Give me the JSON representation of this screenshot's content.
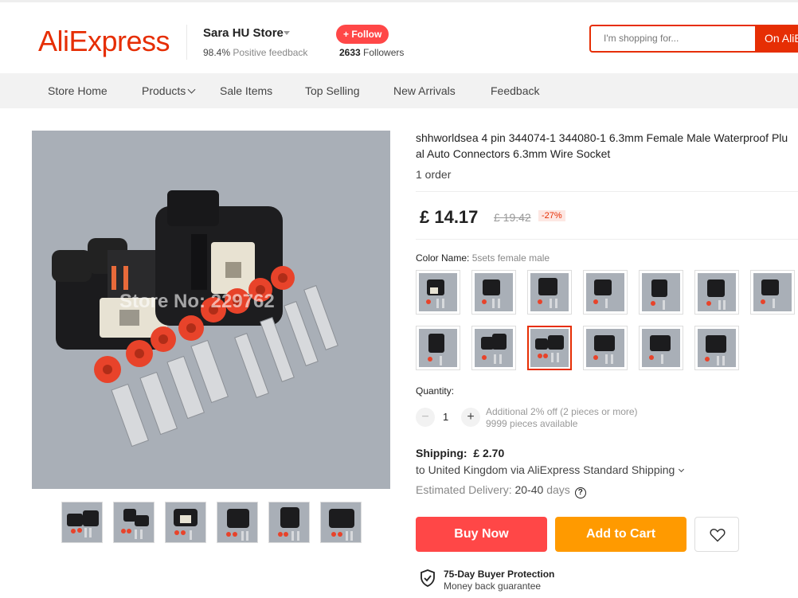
{
  "header": {
    "logo": "AliExpress",
    "store_name": "Sara HU Store",
    "feedback_pct": "98.4%",
    "feedback_label": "Positive feedback",
    "follow_label": "+ Follow",
    "followers_count": "2633",
    "followers_label": "Followers",
    "search_placeholder": "I'm shopping for...",
    "search_button": "On AliE"
  },
  "nav": {
    "items": [
      "Store Home",
      "Products",
      "Sale Items",
      "Top Selling",
      "New Arrivals",
      "Feedback"
    ]
  },
  "gallery": {
    "watermark": "Store No: 229762",
    "thumb_count": 6
  },
  "product": {
    "title_line1": "shhworldsea 4 pin 344074-1 344080-1 6.3mm Female Male Waterproof Plu",
    "title_line2": "al Auto Connectors 6.3mm Wire Socket",
    "orders": "1 order",
    "price": "£ 14.17",
    "original_price": "£ 19.42",
    "discount": "-27%",
    "color_label": "Color Name:",
    "color_value": "5sets female male",
    "swatch_selected_index": 9,
    "quantity_label": "Quantity:",
    "quantity": "1",
    "qty_minus": "−",
    "qty_plus": "+",
    "qty_offer": "Additional 2% off (2 pieces or more)",
    "qty_available": "9999 pieces available",
    "shipping_label": "Shipping:",
    "shipping_price": "£ 2.70",
    "shipping_to": "to United Kingdom via AliExpress Standard Shipping",
    "est_label": "Estimated Delivery:",
    "est_value": "20-40",
    "est_unit": "days",
    "help": "?",
    "buy_now": "Buy Now",
    "add_to_cart": "Add to Cart",
    "protection_title": "75-Day Buyer Protection",
    "protection_sub": "Money back guarantee"
  },
  "colors": {
    "brand": "#e62e04",
    "buy": "#ff4747",
    "cart": "#ff9a00"
  }
}
